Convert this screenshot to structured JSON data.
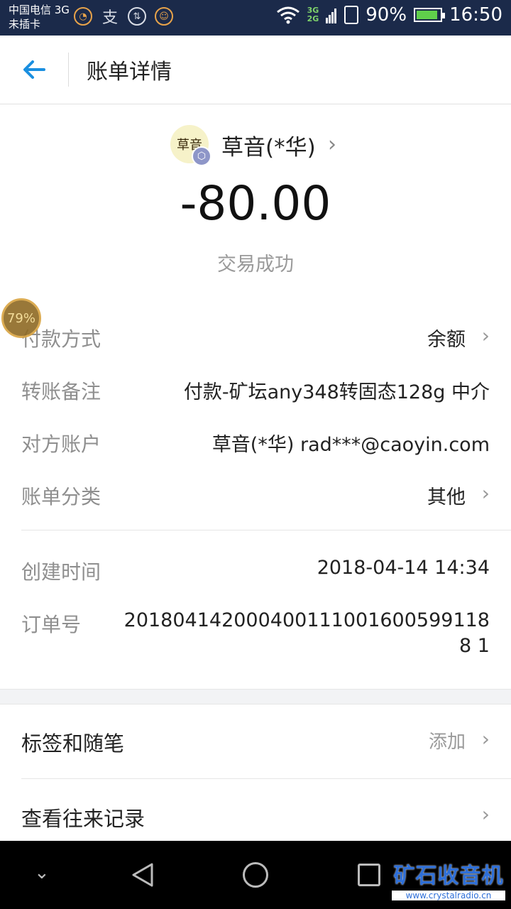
{
  "status_bar": {
    "carrier_line1": "中国电信 3G",
    "carrier_line2": "未插卡",
    "net_top": "3G",
    "net_bottom": "2G",
    "battery_percent": "90%",
    "battery_level": 0.9,
    "time": "16:50"
  },
  "header": {
    "title": "账单详情"
  },
  "merchant": {
    "avatar_text": "草音",
    "name": "草音(*华)"
  },
  "transaction": {
    "amount": "-80.00",
    "status": "交易成功"
  },
  "details": [
    {
      "label": "付款方式",
      "value": "余额"
    },
    {
      "label": "转账备注",
      "value": "付款-矿坛any348转固态128g 中介"
    },
    {
      "label": "对方账户",
      "value": "草音(*华) rad***@caoyin.com"
    },
    {
      "label": "账单分类",
      "value": "其他"
    }
  ],
  "meta": {
    "created_label": "创建时间",
    "created_value": "2018-04-14 14:34",
    "order_label": "订单号",
    "order_value": "2018041420004001110016005991188 1"
  },
  "actions": {
    "tags_label": "标签和随笔",
    "tags_value": "添加",
    "history_label": "查看往来记录"
  },
  "float_badge": "79%",
  "watermark": {
    "title": "矿石收音机",
    "url": "www.crystalradio.cn"
  }
}
